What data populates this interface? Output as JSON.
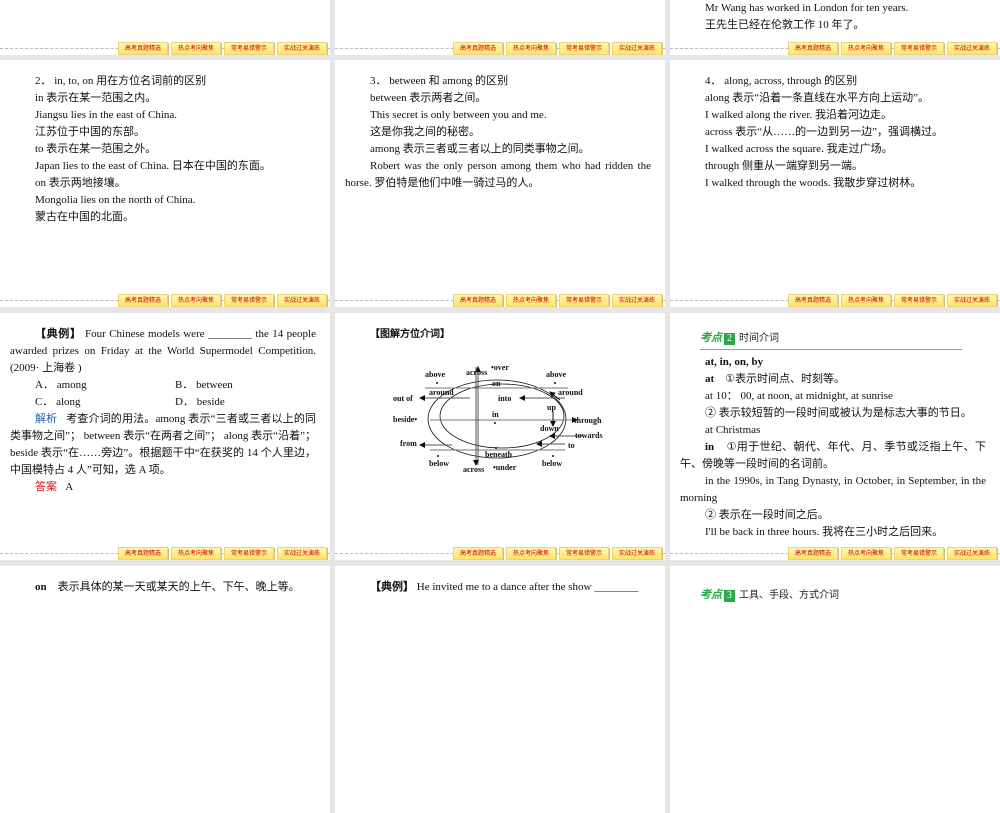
{
  "footer_buttons": [
    "高考真题精选",
    "热点考向聚焦",
    "常考易错警示",
    "实战过关演练"
  ],
  "slides": {
    "top_right": {
      "lines": [
        "Mr Wang has worked in London for ten years.",
        "王先生已经在伦敦工作 10 年了。"
      ]
    },
    "s2": {
      "lines": [
        "2． in, to, on 用在方位名词前的区别",
        "in 表示在某一范围之内。",
        "Jiangsu lies in the east of China.",
        "江苏位于中国的东部。",
        "to 表示在某一范围之外。",
        "Japan lies to the east of China. 日本在中国的东面。",
        "on 表示两地接壤。",
        "Mongolia lies on the north of China.",
        "蒙古在中国的北面。"
      ]
    },
    "s3": {
      "lines": [
        "3． between 和 among 的区别",
        "between 表示两者之间。",
        "This secret is only between you and me.",
        "这是你我之间的秘密。",
        "among 表示三者或三者以上的同类事物之间。",
        "Robert was the only person among them who had ridden the horse. 罗伯特是他们中唯一骑过马的人。"
      ]
    },
    "s4": {
      "lines": [
        "4． along, across, through 的区别",
        "along 表示“沿着一条直线在水平方向上运动”。",
        "I walked along the river. 我沿着河边走。",
        "across 表示“从……的一边到另一边”，强调横过。",
        "I walked across the square. 我走过广场。",
        "through 侧重从一端穿到另一端。",
        "I walked through the woods. 我散步穿过树林。"
      ]
    },
    "s5": {
      "label": "【典例】",
      "question": "Four Chinese models were ________ the 14 people awarded prizes on Friday at the World Supermodel Competition.(2009· 上海卷 )",
      "options": [
        "A． among",
        "B． between",
        "C． along",
        "D． beside"
      ],
      "analysis_label": "解析",
      "analysis": "考查介词的用法。among 表示“三者或三者以上的同类事物之间”； between 表示“在两者之间”； along 表示“沿着”； beside 表示“在……旁边”。根据题干中“在获奖的 14 个人里边，中国模特占 4 人”可知，选 A 项。",
      "answer_label": "答案",
      "answer": "A"
    },
    "s6": {
      "title": "【图解方位介词】",
      "diagram_labels": {
        "above_left": "above",
        "across_top": "across",
        "over": "•over",
        "above_right": "above",
        "on": "on",
        "around_left": "around",
        "around_right": "around",
        "out_of": "out of",
        "into": "into",
        "up": "up",
        "beside": "beside•",
        "in": "in",
        "through": "through",
        "down": "down",
        "towards": "towards",
        "from": "from",
        "to": "to",
        "beneath": "beneath",
        "below_left": "below",
        "below_right": "below",
        "across_bottom": "across",
        "under": "•under"
      }
    },
    "s7": {
      "kaodian": "考点",
      "num": "2",
      "title": "时间介词",
      "heading": "at, in, on, by",
      "at_label": "at",
      "at_text": "①表示时间点、时刻等。",
      "at_ex1": "at 10： 00, at noon, at midnight, at sunrise",
      "at_2": "② 表示较短暂的一段时间或被认为是标志大事的节日。",
      "at_ex2": "at Christmas",
      "in_label": "in",
      "in_text": "①用于世纪、朝代、年代、月、季节或泛指上午、下午、傍晚等一段时间的名词前。",
      "in_ex1": "in the 1990s, in Tang Dynasty, in October, in September, in the morning",
      "in_2": "② 表示在一段时间之后。",
      "in_ex2": "I'll be back in three hours. 我将在三小时之后回来。"
    },
    "s8": {
      "label": "on",
      "text": "表示具体的某一天或某天的上午、下午、晚上等。"
    },
    "s9": {
      "label": "【典例】",
      "text": "He invited me to a dance after the show ________"
    },
    "s10": {
      "kaodian": "考点",
      "num": "3",
      "title": "工具、手段、方式介词"
    }
  },
  "colors": {
    "kaodian": "#2aa84a",
    "analysis": "#1f5fb8",
    "answer": "#d11111",
    "button_text": "#cc0000",
    "button_bg": "#ffe36a"
  }
}
